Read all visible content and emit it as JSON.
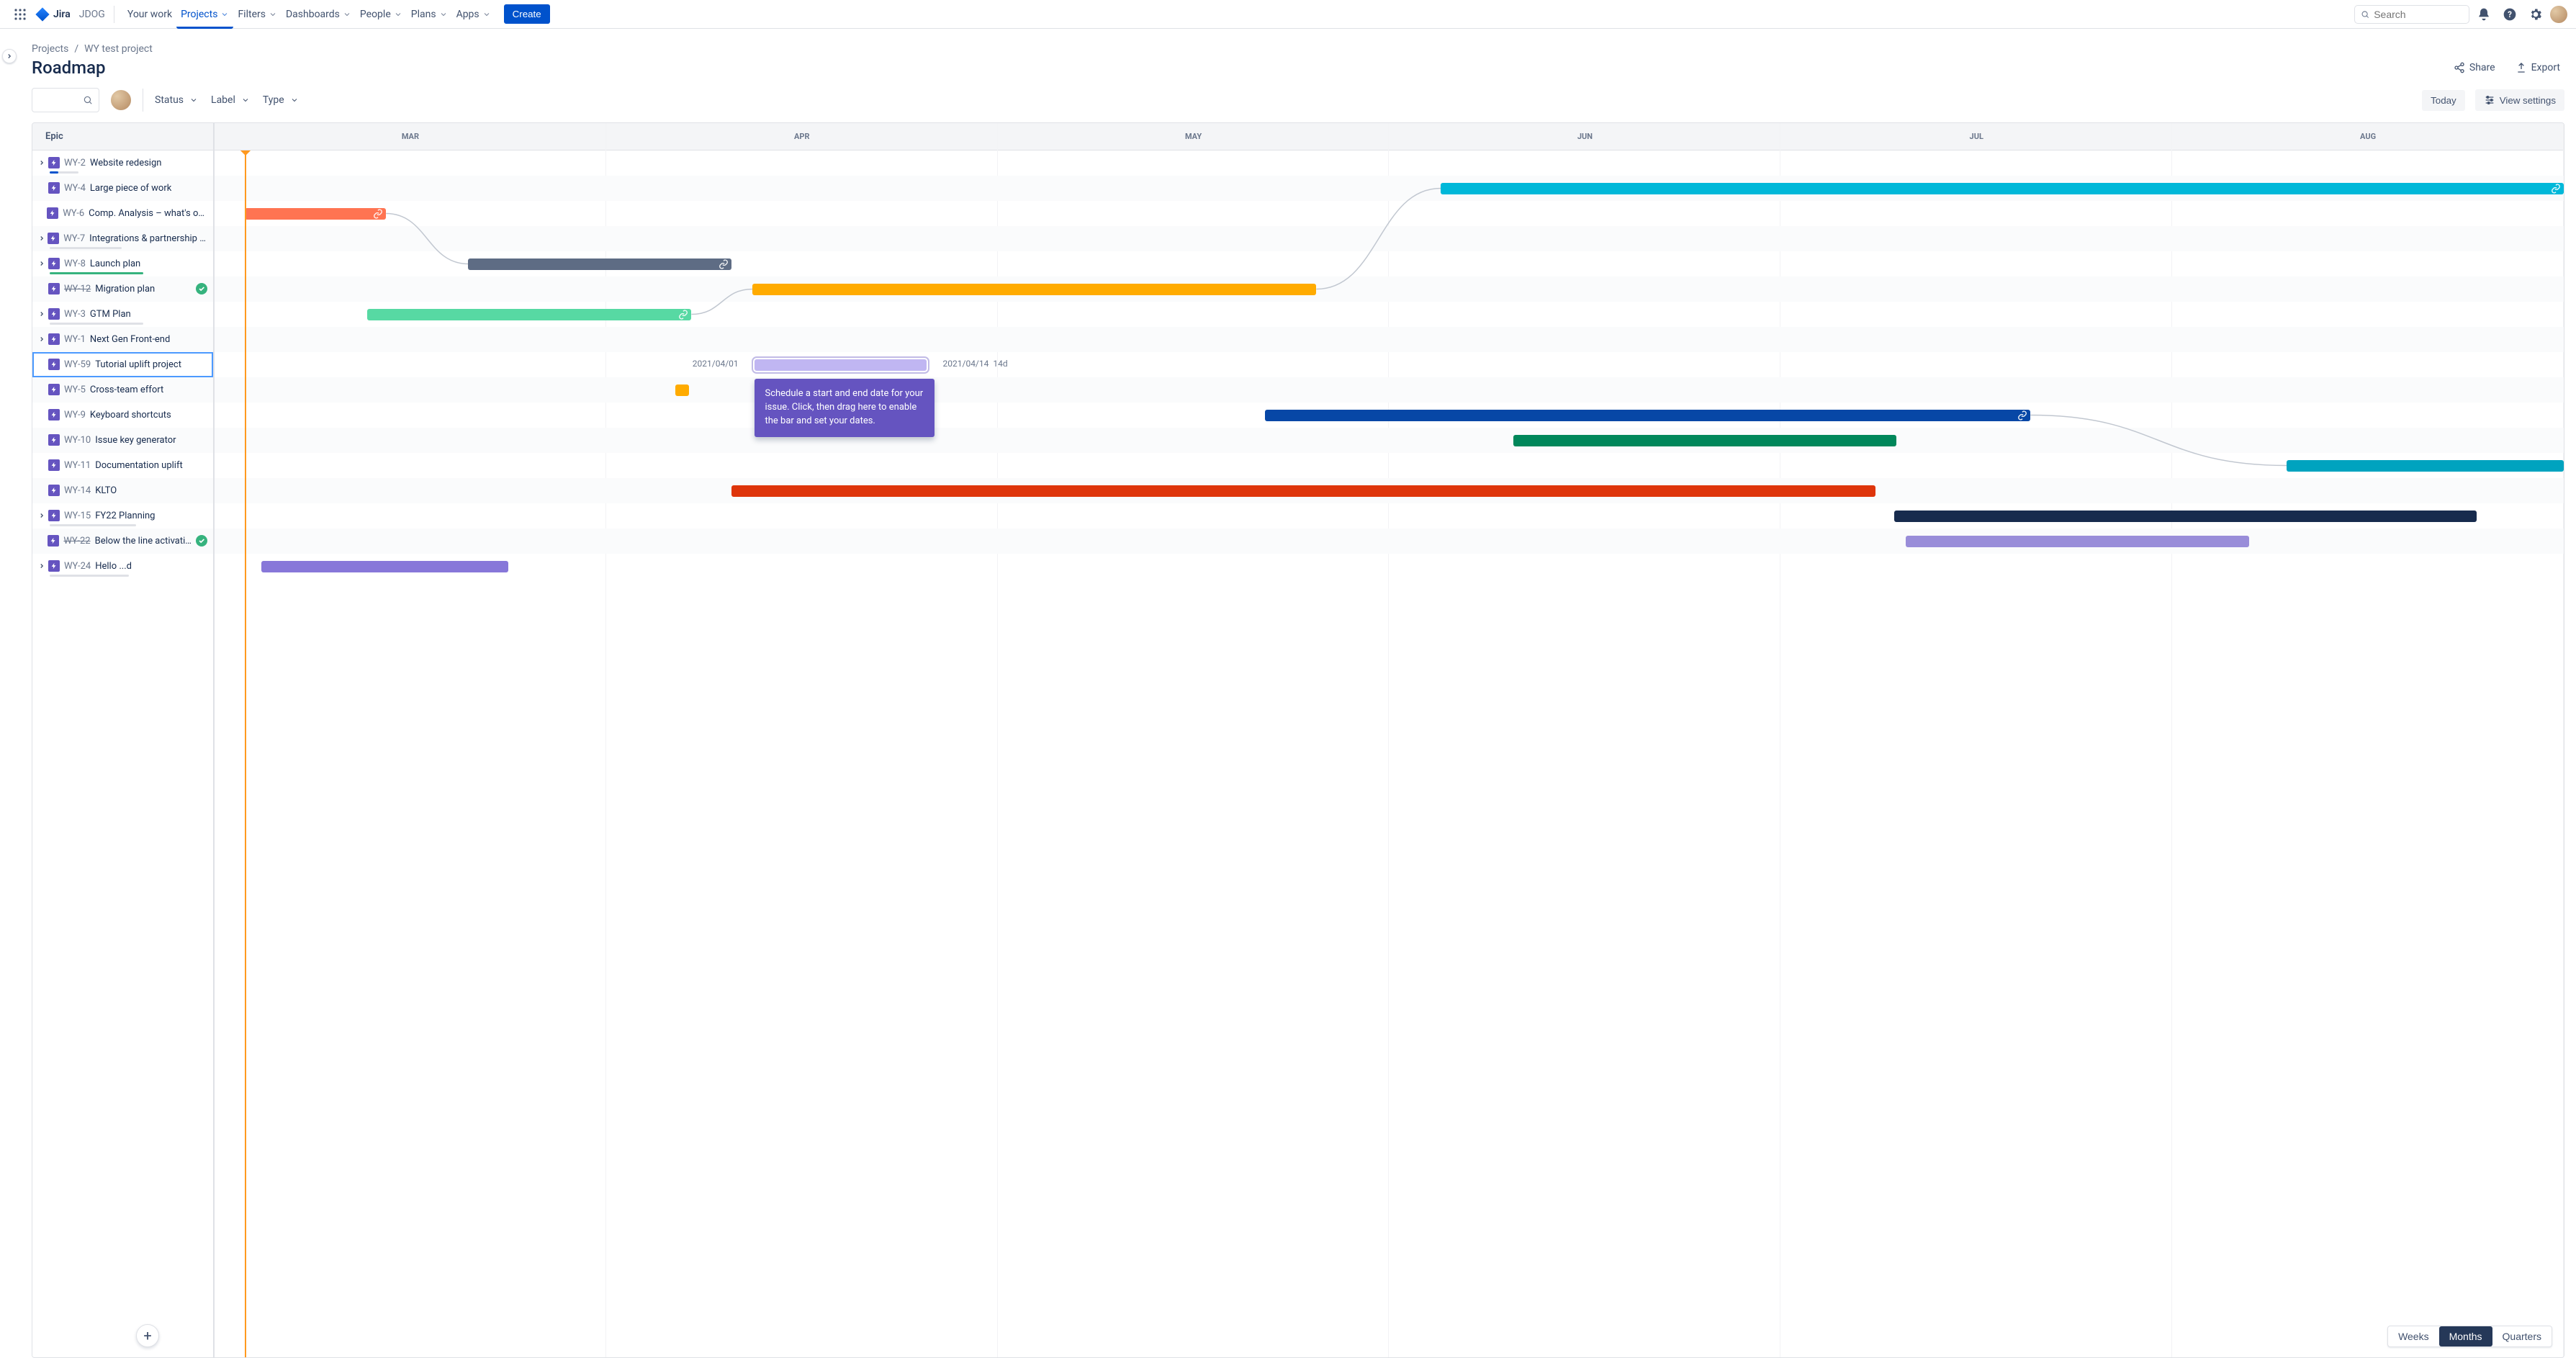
{
  "nav": {
    "product": "Jira",
    "env": "JDOG",
    "items": [
      {
        "label": "Your work",
        "active": false,
        "dropdown": false
      },
      {
        "label": "Projects",
        "active": true,
        "dropdown": true
      },
      {
        "label": "Filters",
        "active": false,
        "dropdown": true
      },
      {
        "label": "Dashboards",
        "active": false,
        "dropdown": true
      },
      {
        "label": "People",
        "active": false,
        "dropdown": true
      },
      {
        "label": "Plans",
        "active": false,
        "dropdown": true
      },
      {
        "label": "Apps",
        "active": false,
        "dropdown": true
      }
    ],
    "create": "Create",
    "search_placeholder": "Search"
  },
  "breadcrumb": {
    "project_root": "Projects",
    "project_name": "WY test project"
  },
  "page_title": "Roadmap",
  "actions": {
    "share": "Share",
    "export": "Export"
  },
  "filters": {
    "status": "Status",
    "label": "Label",
    "type": "Type"
  },
  "toolbar": {
    "today": "Today",
    "view_settings": "View settings"
  },
  "columns": {
    "epic": "Epic"
  },
  "months": [
    "MAR",
    "APR",
    "MAY",
    "JUN",
    "JUL",
    "AUG"
  ],
  "zoom": {
    "weeks": "Weeks",
    "months": "Months",
    "quarters": "Quarters",
    "active": "Months"
  },
  "selected_bar": {
    "start_label": "2021/04/01",
    "end_label": "2021/04/14",
    "duration_label": "14d"
  },
  "tooltip_text": "Schedule a start and end date for your issue. Click, then drag here to enable the bar and set your dates.",
  "epics": [
    {
      "key": "WY-2",
      "title": "Website redesign",
      "expand": true,
      "done": false,
      "progress": {
        "w": 40,
        "pct": 30,
        "color": "#0052CC"
      }
    },
    {
      "key": "WY-4",
      "title": "Large piece of work",
      "expand": false,
      "done": false,
      "bar": {
        "left": 52.2,
        "width": 47.8,
        "color": "#00B8D9",
        "link": true
      }
    },
    {
      "key": "WY-6",
      "title": "Comp. Analysis – what's out th...",
      "expand": false,
      "done": false,
      "bar": {
        "left": 1.3,
        "width": 6.0,
        "color": "#FF7452",
        "link": true
      }
    },
    {
      "key": "WY-7",
      "title": "Integrations & partnership API",
      "expand": true,
      "done": false,
      "progress": {
        "w": 100,
        "pct": 0,
        "color": "#DFE1E6"
      }
    },
    {
      "key": "WY-8",
      "title": "Launch plan",
      "expand": true,
      "done": false,
      "progress": {
        "w": 130,
        "pct": 100,
        "color": "#36B37E"
      },
      "bar": {
        "left": 10.8,
        "width": 11.2,
        "color": "#5E6C84",
        "link": true
      }
    },
    {
      "key": "WY-12",
      "title": "Migration plan",
      "expand": false,
      "done": true,
      "bar": {
        "left": 22.9,
        "width": 24.0,
        "color": "#FFAB00"
      }
    },
    {
      "key": "WY-3",
      "title": "GTM Plan",
      "expand": true,
      "done": false,
      "progress": {
        "w": 130,
        "pct": 0,
        "color": "#DFE1E6"
      },
      "bar": {
        "left": 6.5,
        "width": 13.8,
        "color": "#57D9A3",
        "link": true
      }
    },
    {
      "key": "WY-1",
      "title": "Next Gen Front-end",
      "expand": true,
      "done": false
    },
    {
      "key": "WY-59",
      "title": "Tutorial uplift project",
      "expand": false,
      "done": false,
      "selected": true,
      "bar": {
        "left": 23.0,
        "width": 7.3,
        "color": "#C0B6F2",
        "sel": true
      }
    },
    {
      "key": "WY-5",
      "title": "Cross-team effort",
      "expand": false,
      "done": false,
      "accent": {
        "left": 19.6,
        "width": 0.6,
        "color": "#FFAB00"
      }
    },
    {
      "key": "WY-9",
      "title": "Keyboard shortcuts",
      "expand": false,
      "done": false,
      "bar": {
        "left": 44.7,
        "width": 32.6,
        "color": "#0747A6",
        "link": true
      }
    },
    {
      "key": "WY-10",
      "title": "Issue key generator",
      "expand": false,
      "done": false,
      "bar": {
        "left": 55.3,
        "width": 16.3,
        "color": "#00875A"
      }
    },
    {
      "key": "WY-11",
      "title": "Documentation uplift",
      "expand": false,
      "done": false,
      "bar": {
        "left": 88.2,
        "width": 11.8,
        "color": "#00A3BF"
      }
    },
    {
      "key": "WY-14",
      "title": "KLTO",
      "expand": false,
      "done": false,
      "bar": {
        "left": 22.0,
        "width": 48.7,
        "color": "#DE350B"
      }
    },
    {
      "key": "WY-15",
      "title": "FY22 Planning",
      "expand": true,
      "done": false,
      "progress": {
        "w": 120,
        "pct": 0,
        "color": "#DFE1E6"
      },
      "bar": {
        "left": 71.5,
        "width": 24.8,
        "color": "#172B4D"
      }
    },
    {
      "key": "WY-22",
      "title": "Below the line activations",
      "expand": false,
      "done": true,
      "bar": {
        "left": 72.0,
        "width": 14.6,
        "color": "#998DD9"
      }
    },
    {
      "key": "WY-24",
      "title": "Hello ...d",
      "expand": true,
      "done": false,
      "progress": {
        "w": 110,
        "pct": 0,
        "color": "#DFE1E6"
      },
      "bar": {
        "left": 2.0,
        "width": 10.5,
        "color": "#8777D9"
      }
    }
  ],
  "dependencies": [
    {
      "from": 2,
      "fromX": 7.3,
      "to": 4,
      "toX": 10.8
    },
    {
      "from": 6,
      "fromX": 20.3,
      "to": 5,
      "toX": 22.9
    },
    {
      "from": 5,
      "fromX": 46.9,
      "to": 1,
      "toX": 52.2
    },
    {
      "from": 10,
      "fromX": 77.3,
      "to": 12,
      "toX": 88.2
    }
  ]
}
